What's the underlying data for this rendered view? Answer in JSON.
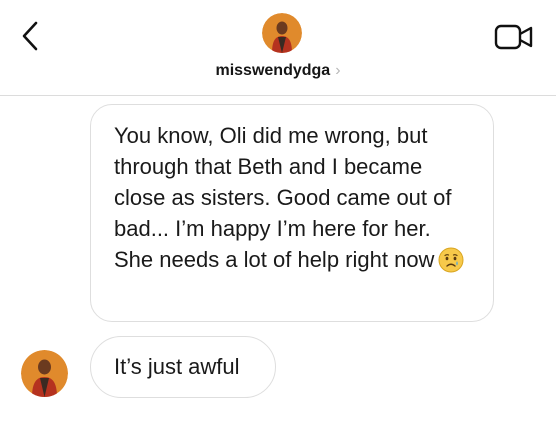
{
  "header": {
    "username": "misswendydga",
    "chevron": "›",
    "back_icon": "chevron-left-icon",
    "video_icon": "video-camera-icon"
  },
  "messages": [
    {
      "sender": "other",
      "text": "You know, Oli did me wrong, but through that Beth and I became close as sisters. Good came out of bad... I’m happy I’m here for her. She needs a lot of help right now",
      "emoji": "crying-face-icon"
    },
    {
      "sender": "other",
      "text": "It’s just awful"
    }
  ],
  "colors": {
    "header_border": "#dcdcdc",
    "bubble_border": "#dedede",
    "avatar_bg": "#e08a2c",
    "emoji_face": "#f7c94a",
    "emoji_tear": "#4aa8e8"
  }
}
